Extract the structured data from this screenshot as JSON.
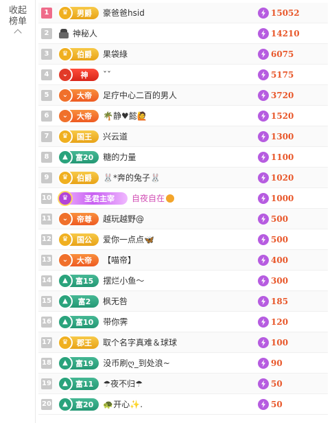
{
  "sidebar": {
    "collapse_label_line1": "收起",
    "collapse_label_line2": "榜单"
  },
  "colors": {
    "score": "#e8572a",
    "rank_top": "#ef6b8a",
    "rank_normal": "#c9c9c9",
    "coin": "#b65ce0"
  },
  "rows": [
    {
      "rank": "1",
      "badge": "男爵",
      "badge_style": "gold",
      "name": "豪爸爸hsid",
      "score": "15052"
    },
    {
      "rank": "2",
      "badge": "",
      "badge_style": "none",
      "name": "神秘人",
      "score": "14210"
    },
    {
      "rank": "3",
      "badge": "伯爵",
      "badge_style": "gold",
      "name": "果袋綠",
      "score": "6075"
    },
    {
      "rank": "4",
      "badge": "神",
      "badge_style": "red",
      "name": "ˇˇ",
      "score": "5175"
    },
    {
      "rank": "5",
      "badge": "大帝",
      "badge_style": "orange",
      "name": "足疗中心二百的男人",
      "score": "3720"
    },
    {
      "rank": "6",
      "badge": "大帝",
      "badge_style": "orange",
      "name": "🌴静♥懿🙋",
      "score": "1520"
    },
    {
      "rank": "7",
      "badge": "国王",
      "badge_style": "gold",
      "name": "兴云道",
      "score": "1300"
    },
    {
      "rank": "8",
      "badge": "富20",
      "badge_style": "teal",
      "name": "糖的力量",
      "score": "1100"
    },
    {
      "rank": "9",
      "badge": "伯爵",
      "badge_style": "gold",
      "name": "🐰*奔的兔子🐰",
      "score": "1020"
    },
    {
      "rank": "10",
      "badge": "圣君主宰",
      "badge_style": "purple",
      "name": "自夜自在",
      "score": "1000"
    },
    {
      "rank": "11",
      "badge": "帝尊",
      "badge_style": "orange",
      "name": "越玩越野@",
      "score": "500"
    },
    {
      "rank": "12",
      "badge": "国公",
      "badge_style": "gold",
      "name": "爱你一点点🦋",
      "score": "500"
    },
    {
      "rank": "13",
      "badge": "大帝",
      "badge_style": "orange",
      "name": "【喵帝】",
      "score": "400"
    },
    {
      "rank": "14",
      "badge": "富15",
      "badge_style": "teal",
      "name": "摆烂小鱼～",
      "score": "300"
    },
    {
      "rank": "15",
      "badge": "富2",
      "badge_style": "teal",
      "name": "枫无咎",
      "score": "185"
    },
    {
      "rank": "16",
      "badge": "富10",
      "badge_style": "teal",
      "name": "带你霁",
      "score": "120"
    },
    {
      "rank": "17",
      "badge": "郡王",
      "badge_style": "gold",
      "name": "取个名字真难＆球球",
      "score": "100"
    },
    {
      "rank": "18",
      "badge": "富19",
      "badge_style": "teal",
      "name": "没币刷ღ_到处浪~",
      "score": "90"
    },
    {
      "rank": "19",
      "badge": "富11",
      "badge_style": "teal",
      "name": "☂夜不归☂",
      "score": "50"
    },
    {
      "rank": "20",
      "badge": "富20",
      "badge_style": "teal",
      "name": "🐢开心✨.",
      "score": "50"
    }
  ]
}
